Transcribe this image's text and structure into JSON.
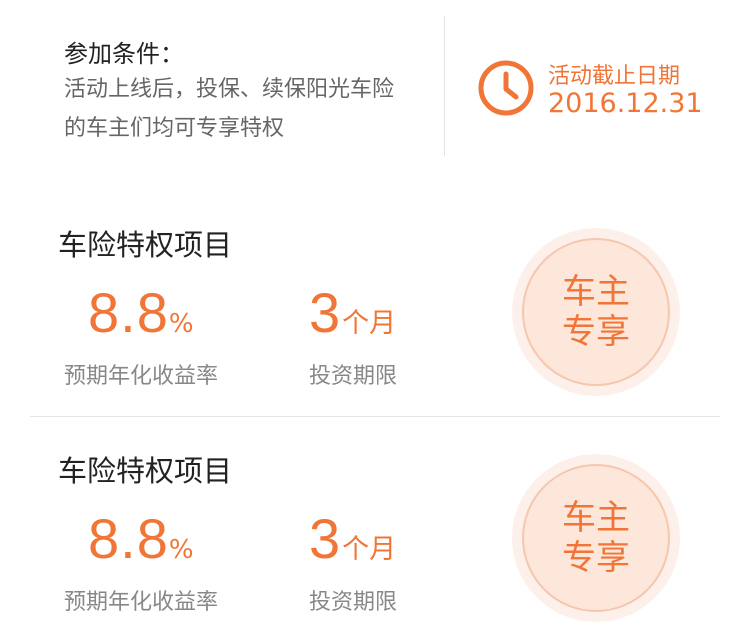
{
  "conditions": {
    "title": "参加条件：",
    "line1": "活动上线后，投保、续保阳光车险",
    "line2": "的车主们均可专享特权"
  },
  "deadline": {
    "label": "活动截止日期",
    "date": "2016.12.31",
    "icon": "clock-icon"
  },
  "colors": {
    "accent": "#f07536",
    "badge_bg": "#fde6da",
    "text_primary": "#222222",
    "text_secondary": "#888888"
  },
  "cards": [
    {
      "title": "车险特权项目",
      "rate_value": "8.8",
      "rate_unit": "%",
      "rate_label": "预期年化收益率",
      "term_value": "3",
      "term_unit": "个月",
      "term_label": "投资期限",
      "badge_line1": "车主",
      "badge_line2": "专享"
    },
    {
      "title": "车险特权项目",
      "rate_value": "8.8",
      "rate_unit": "%",
      "rate_label": "预期年化收益率",
      "term_value": "3",
      "term_unit": "个月",
      "term_label": "投资期限",
      "badge_line1": "车主",
      "badge_line2": "专享"
    }
  ]
}
